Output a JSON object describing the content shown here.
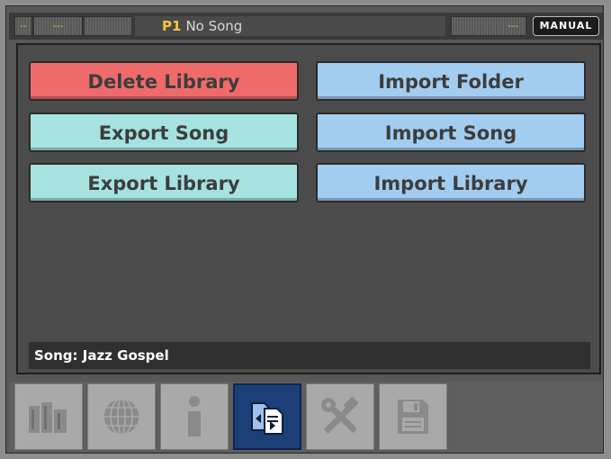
{
  "status": {
    "seg_a": "--",
    "seg_b": "---",
    "program": "P1",
    "song": "No Song",
    "seg_right": "---",
    "mode": "MANUAL"
  },
  "actions": {
    "delete_library": "Delete Library",
    "export_song": "Export Song",
    "export_library": "Export Library",
    "import_folder": "Import Folder",
    "import_song": "Import Song",
    "import_library": "Import Library"
  },
  "song_bar": {
    "text": "Song:  Jazz Gospel"
  },
  "tabs": [
    {
      "icon": "library-books-icon",
      "active": false
    },
    {
      "icon": "globe-grid-icon",
      "active": false
    },
    {
      "icon": "info-icon",
      "active": false
    },
    {
      "icon": "file-transfer-icon",
      "active": true
    },
    {
      "icon": "tools-icon",
      "active": false
    },
    {
      "icon": "floppy-disk-icon",
      "active": false
    }
  ],
  "colors": {
    "delete": "#ef6b6b",
    "export": "#a6e3e0",
    "import": "#a3cdf0",
    "active_tab": "#1c3f78"
  }
}
